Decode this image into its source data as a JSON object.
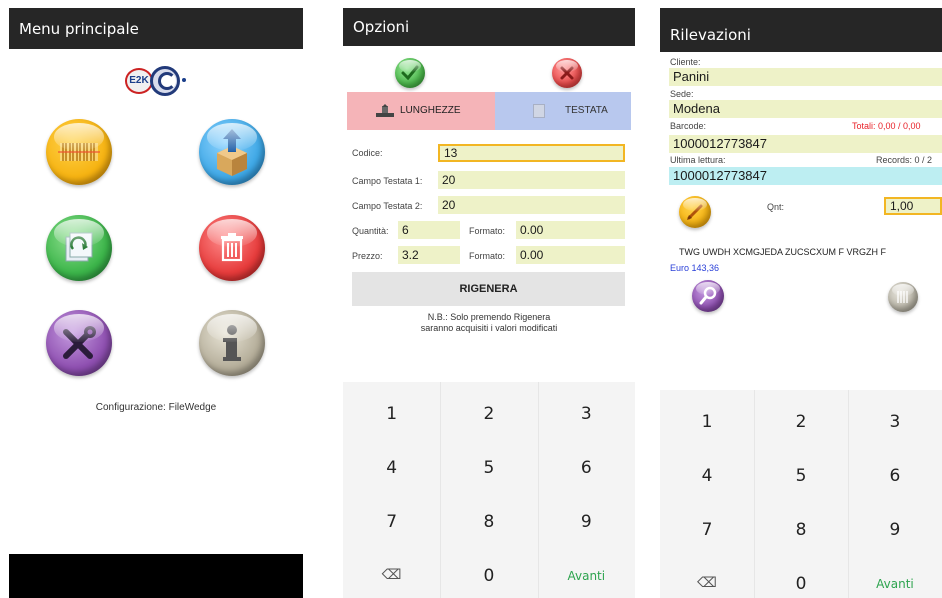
{
  "colors": {
    "topbar": "#262626",
    "field_bg": "#eef2c8",
    "barcode_highlight": "#bdeef2",
    "tab_active": "#f5b4b8",
    "tab_inactive": "#b8c8ee",
    "total_red": "#e8232a",
    "euro_blue": "#2a40d8",
    "avanti_green": "#2ea44f"
  },
  "menu": {
    "title": "Menu principale",
    "logo_text": "E2K",
    "buttons": [
      {
        "name": "barcode-icon",
        "color": "#f6b312"
      },
      {
        "name": "upload-box-icon",
        "color": "#3fa8e6"
      },
      {
        "name": "sync-icon",
        "color": "#3cb54a"
      },
      {
        "name": "trash-icon",
        "color": "#e63b3b"
      },
      {
        "name": "tools-icon",
        "color": "#8e4fb0"
      },
      {
        "name": "info-icon",
        "color": "#b5ae9a"
      }
    ],
    "config_text": "Configurazione: FileWedge"
  },
  "options": {
    "title": "Opzioni",
    "confirm_icon": "check-icon",
    "cancel_icon": "close-icon",
    "tab_lunghezze": "LUNGHEZZE",
    "tab_testata": "TESTATA",
    "codice_label": "Codice:",
    "codice_value": "13",
    "campo1_label": "Campo Testata 1:",
    "campo1_value": "20",
    "campo2_label": "Campo Testata 2:",
    "campo2_value": "20",
    "quantita_label": "Quantità:",
    "quantita_value": "6",
    "formato1_label": "Formato:",
    "formato1_value": "0.00",
    "prezzo_label": "Prezzo:",
    "prezzo_value": "3.2",
    "formato2_label": "Formato:",
    "formato2_value": "0.00",
    "rigenera_label": "RIGENERA",
    "note_line1": "N.B.: Solo premendo Rigenera",
    "note_line2": "saranno acquisiti i valori modificati"
  },
  "keypad": {
    "keys": [
      "1",
      "2",
      "3",
      "4",
      "5",
      "6",
      "7",
      "8",
      "9",
      "⌫",
      "0",
      "Avanti"
    ]
  },
  "rilevazioni": {
    "title": "Rilevazioni",
    "cliente_label": "Cliente:",
    "cliente_value": "Panini",
    "sede_label": "Sede:",
    "sede_value": "Modena",
    "barcode_label": "Barcode:",
    "totali_text": "Totali: 0,00 / 0,00",
    "barcode_value": "1000012773847",
    "ultima_label": "Ultima lettura:",
    "records_text": "Records: 0 / 2",
    "ultima_value": "1000012773847",
    "qnt_label": "Qnt:",
    "qnt_value": "1,00",
    "description": "TWG UWDH XCMGJEDA ZUCSCXUM  F VRGZH F",
    "price": "Euro 143,36"
  }
}
